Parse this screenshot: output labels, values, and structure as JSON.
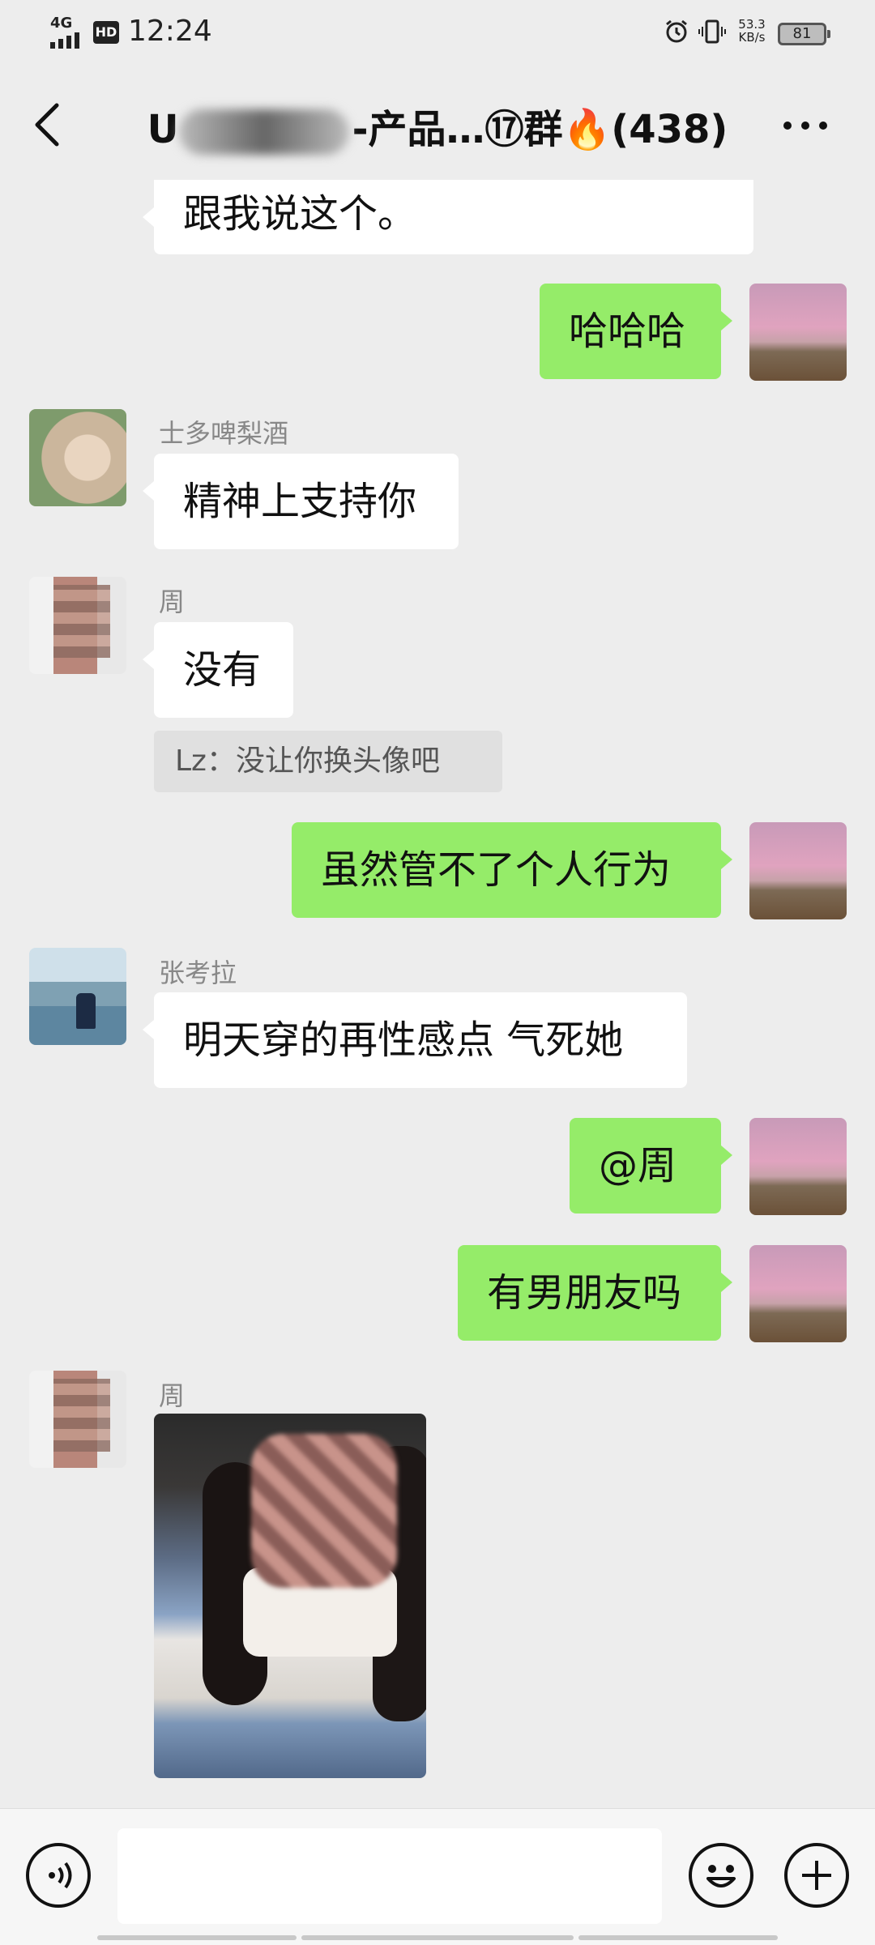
{
  "status_bar": {
    "network": "4G",
    "hd": "HD",
    "time": "12:24",
    "speed_value": "53.3",
    "speed_unit": "KB/s",
    "battery": "81"
  },
  "header": {
    "title_prefix": "U",
    "title_suffix": "-产品…⑰群🔥(438)"
  },
  "messages": {
    "m0_text": "跟我说这个。",
    "m1_text": "哈哈哈",
    "m2_sender": "士多啤梨酒",
    "m2_text": "精神上支持你",
    "m3_sender": "周",
    "m3_text": "没有",
    "m3_quote": "Lz：没让你换头像吧",
    "m4_text": "虽然管不了个人行为",
    "m5_sender": "张考拉",
    "m5_text": "明天穿的再性感点  气死她",
    "m6_text": "@周",
    "m7_text": "有男朋友吗",
    "m8_sender": "周"
  },
  "icons": {
    "back": "chevron-left-icon",
    "more": "more-icon",
    "voice": "voice-icon",
    "emoji": "emoji-icon",
    "plus": "plus-icon"
  },
  "colors": {
    "bubble_self": "#95ec69",
    "bubble_other": "#ffffff",
    "background": "#ededed"
  }
}
